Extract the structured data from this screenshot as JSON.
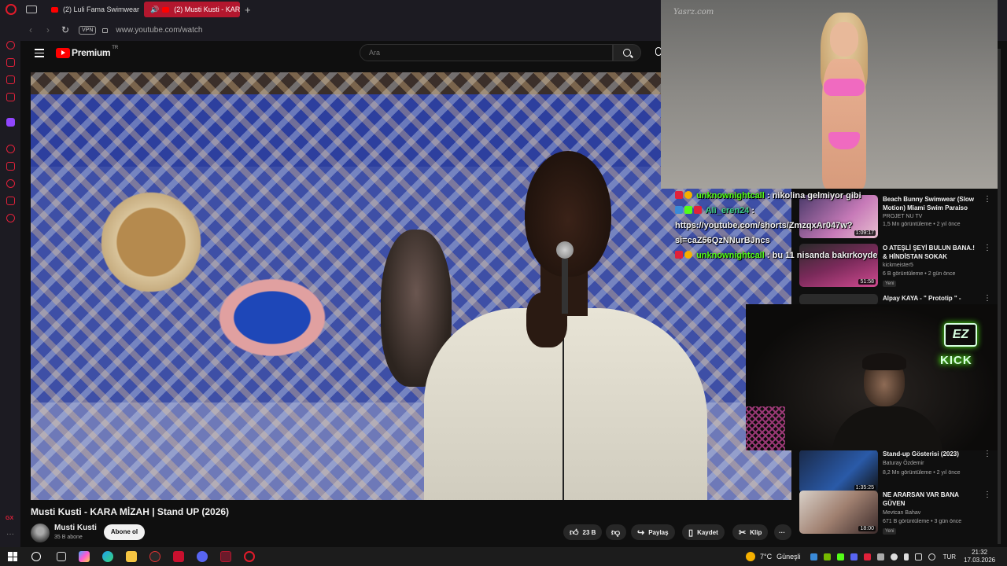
{
  "browser": {
    "tabs": [
      {
        "label": "(2) Luli Fama Swimwear Fa"
      },
      {
        "label": "(2) Musti Kusti - KARA"
      }
    ],
    "new_tab_label": "+",
    "vpn_label": "VPN",
    "url": "www.youtube.com/watch"
  },
  "youtube": {
    "brand": "Premium",
    "region": "TR",
    "search_placeholder": "Ara",
    "video": {
      "title": "Musti Kusti - KARA MİZAH  | Stand UP (2026)",
      "channel": "Musti Kusti",
      "subscribers": "35 B abone",
      "subscribe_label": "Abone ol",
      "likes": "23 B",
      "share_label": "Paylaş",
      "save_label": "Kaydet",
      "clip_label": "Klip"
    },
    "recommendations": [
      {
        "title": "Beach Bunny Swimwear (Slow Motion) Miami Swim Paraiso Mia...",
        "channel": "PROJET NU TV",
        "meta": "1,5 Mn görüntüleme • 2 yıl önce",
        "duration": "1:09:17",
        "is_new": false
      },
      {
        "title": "O ATEŞLİ ŞEYİ BULUN BANA.! & HİNDİSTAN SOKAK LEZZETLE...",
        "channel": "kickmeister5",
        "meta": "6 B görüntüleme • 2 gün önce",
        "duration": "51:58",
        "is_new": true
      },
      {
        "title": "Alpay KAYA - \" Prototip \" -",
        "channel": "",
        "meta": "",
        "duration": "",
        "is_new": false
      },
      {
        "title": "Stand-up Gösterisi (2023)",
        "channel": "Baturay Özdemir",
        "meta": "8,2 Mn görüntüleme • 2 yıl önce",
        "duration": "1:35:25",
        "is_new": false
      },
      {
        "title": "NE ARARSAN VAR BANA GÜVEN",
        "channel": "Mevtcan Bahav",
        "meta": "671 B görüntüleme • 3 gün önce",
        "duration": "18:00",
        "is_new": true
      }
    ],
    "new_badge": "Yeni"
  },
  "overlay": {
    "watermark": "Yasrz.com",
    "chat": [
      {
        "user": "unknownightcall",
        "message": ": nikolina gelmiyor gibi"
      },
      {
        "user": "Ali_eren24",
        "message": ": https://youtube.com/shorts/ZmzqxAr047w?si=caZ56QzNNurBJncs"
      },
      {
        "user": "unknownightcall",
        "message": ": bu 11 nisanda bakırkoyde"
      }
    ],
    "neon_ez": "EZ",
    "neon_kick": "KICK"
  },
  "taskbar": {
    "weather": "7°C",
    "weather_label": "Güneşli",
    "lang": "TUR",
    "time": "21:32",
    "date": "17.03.2026"
  },
  "colors": {
    "opera_red": "#e0213a",
    "youtube_red": "#ff0000",
    "kick_green": "#53fc18",
    "bikini_pink": "#f06ac0"
  }
}
